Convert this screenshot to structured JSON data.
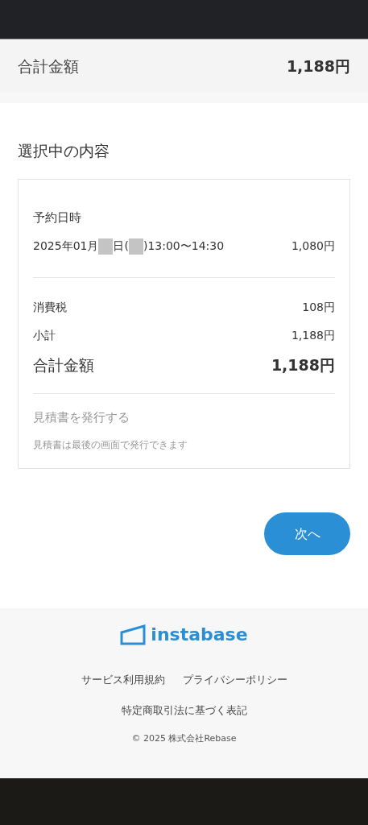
{
  "summary_bar": {
    "label": "合計金額",
    "amount": "1,188円"
  },
  "section_title": "選択中の内容",
  "booking": {
    "label": "予約日時",
    "date_segments": [
      {
        "kind": "text",
        "text": "2025年01月"
      },
      {
        "kind": "redacted"
      },
      {
        "kind": "text",
        "text": "日("
      },
      {
        "kind": "redacted"
      },
      {
        "kind": "text",
        "text": ")13:00〜14:30"
      }
    ],
    "price": "1,080円"
  },
  "lines": [
    {
      "label": "消費税",
      "amount": "108円"
    },
    {
      "label": "小計",
      "amount": "1,188円"
    }
  ],
  "total": {
    "label": "合計金額",
    "amount": "1,188円"
  },
  "estimate": {
    "title": "見積書を発行する",
    "note": "見積書は最後の画面で発行できます"
  },
  "next_button": "次へ",
  "footer": {
    "logo": "instabase",
    "links": [
      "サービス利用規約",
      "プライバシーポリシー",
      "特定商取引法に基づく表記"
    ],
    "copyright": "© 2025 株式会社Rebase"
  }
}
